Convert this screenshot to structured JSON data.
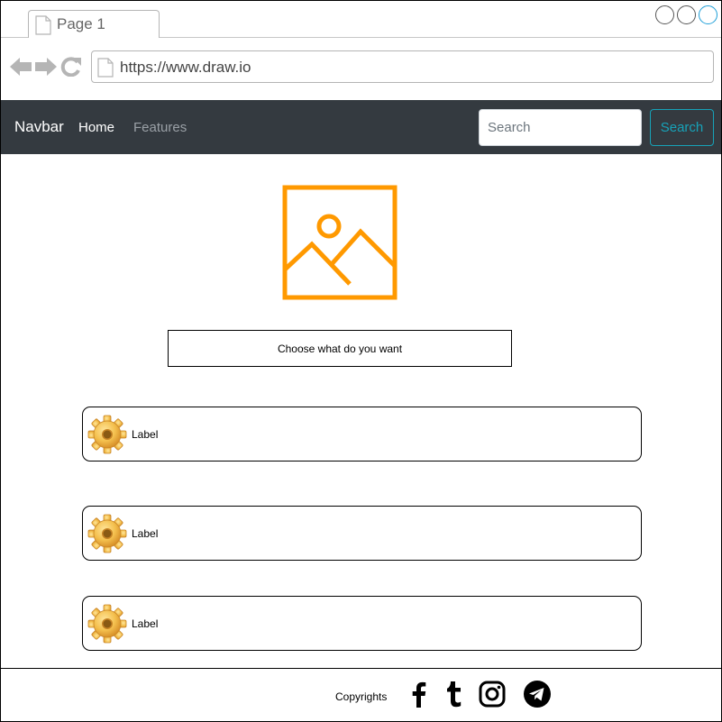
{
  "browser": {
    "tab_title": "Page 1",
    "url": "https://www.draw.io"
  },
  "navbar": {
    "brand": "Navbar",
    "links": [
      "Home",
      "Features"
    ],
    "search_placeholder": "Search",
    "search_button": "Search"
  },
  "content": {
    "select_text": "Choose what do you want",
    "cards": [
      {
        "label": "Label",
        "icon": "gear-icon"
      },
      {
        "label": "Label",
        "icon": "gear-icon"
      },
      {
        "label": "Label",
        "icon": "gear-icon"
      }
    ]
  },
  "footer": {
    "copyright": "Copyrights",
    "social_icons": [
      "facebook-icon",
      "tumblr-icon",
      "instagram-icon",
      "telegram-icon"
    ]
  },
  "colors": {
    "navbar_bg": "#343a40",
    "accent_teal": "#17a2b8",
    "image_orange": "#ff9900"
  }
}
